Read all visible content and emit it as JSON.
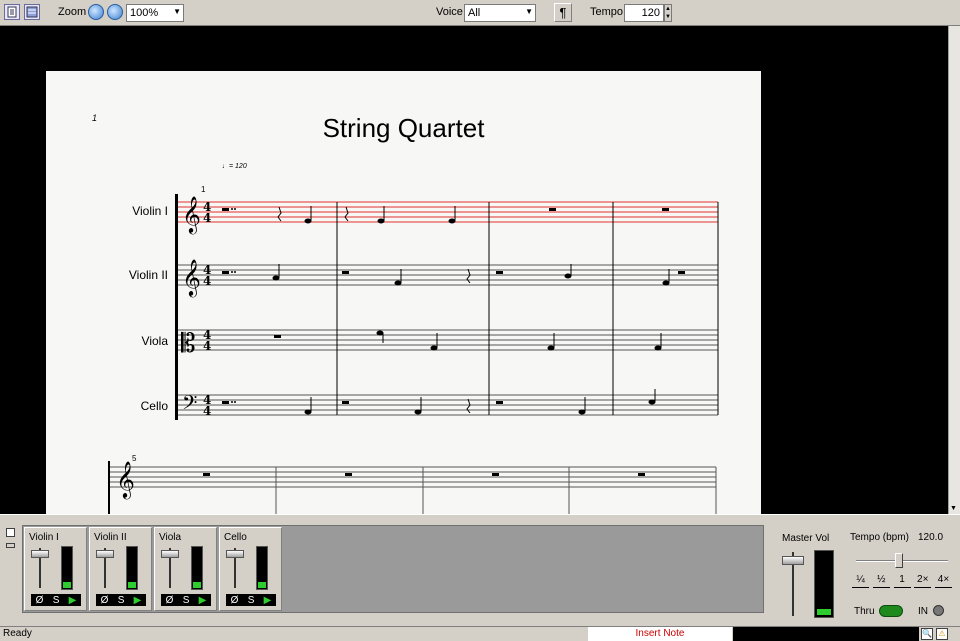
{
  "toolbar": {
    "zoom_label": "Zoom",
    "zoom_value": "100%",
    "voice_label": "Voice",
    "voice_value": "All",
    "paragraph_symbol": "¶",
    "tempo_label": "Tempo",
    "tempo_value": "120"
  },
  "score": {
    "page_number": "1",
    "title": "String Quartet",
    "tempo_marking": "= 120",
    "measure_number_1": "1",
    "measure_number_5": "5",
    "instruments": [
      "Violin I",
      "Violin II",
      "Viola",
      "Cello"
    ]
  },
  "mixer": {
    "channels": [
      {
        "name": "Violin I",
        "mute": "Ø",
        "solo": "S"
      },
      {
        "name": "Violin II",
        "mute": "Ø",
        "solo": "S"
      },
      {
        "name": "Viola",
        "mute": "Ø",
        "solo": "S"
      },
      {
        "name": "Cello",
        "mute": "Ø",
        "solo": "S"
      }
    ],
    "master_label": "Master Vol",
    "tempo_label": "Tempo (bpm)",
    "tempo_value": "120.0",
    "speed_buttons": [
      "¼",
      "½",
      "1",
      "2×",
      "4×"
    ],
    "thru_label": "Thru",
    "in_label": "IN"
  },
  "status": {
    "ready": "Ready",
    "mode": "Insert Note"
  },
  "colors": {
    "selected_staff": "#e03030",
    "meter_green": "#2ecc2e",
    "mode_text": "#cc0000"
  }
}
